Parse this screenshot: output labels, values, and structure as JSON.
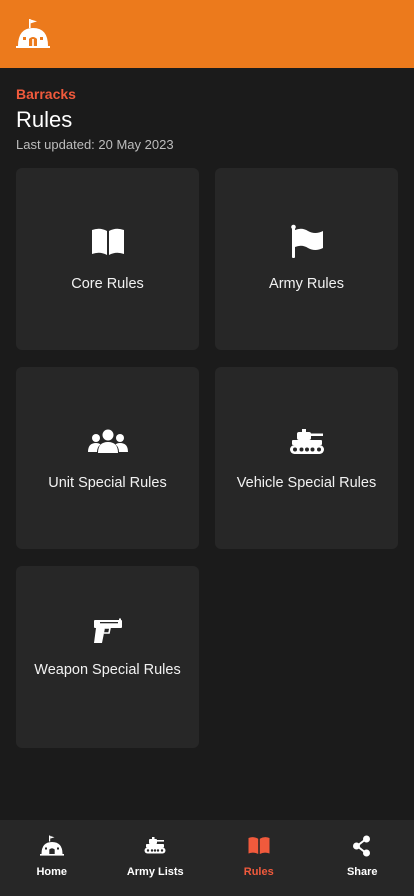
{
  "colors": {
    "brand": "#ec7a1c",
    "accent": "#f15a3c",
    "background": "#1b1b1b",
    "card": "#272727"
  },
  "header": {
    "breadcrumb": "Barracks",
    "title": "Rules",
    "last_updated": "Last updated: 20 May 2023"
  },
  "cards": [
    {
      "label": "Core Rules",
      "icon": "open-book-icon"
    },
    {
      "label": "Army Rules",
      "icon": "flag-icon"
    },
    {
      "label": "Unit Special Rules",
      "icon": "users-group-icon"
    },
    {
      "label": "Vehicle Special Rules",
      "icon": "tank-icon"
    },
    {
      "label": "Weapon Special Rules",
      "icon": "pistol-icon"
    }
  ],
  "nav": {
    "items": [
      {
        "label": "Home",
        "icon": "barracks-icon"
      },
      {
        "label": "Army Lists",
        "icon": "tank-icon"
      },
      {
        "label": "Rules",
        "icon": "open-book-icon"
      },
      {
        "label": "Share",
        "icon": "share-icon"
      }
    ],
    "active": "Rules"
  }
}
